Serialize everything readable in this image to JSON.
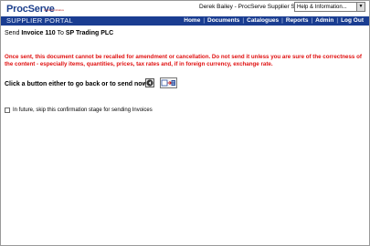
{
  "brand": {
    "logo_text": "ProcServe",
    "logo_sub": "A Fiscal initiative"
  },
  "header": {
    "user_info": "Derek Bailey - ProcServe Supplier Solutions Limited",
    "help_select": "Help & Information..."
  },
  "nav": {
    "portal_title": "SUPPLIER PORTAL",
    "links": [
      "Home",
      "Documents",
      "Catalogues",
      "Reports",
      "Admin",
      "Log Out"
    ],
    "separator": "|"
  },
  "send": {
    "prefix": "Send",
    "doc": "Invoice 110",
    "to": "To",
    "recipient": "SP Trading PLC"
  },
  "warning": "Once sent, this document cannot be recalled for amendment or cancellation. Do not send it unless you are sure of the correctness of the content - especially items, quantities, prices, tax rates and, if in foreign currency, exchange rate.",
  "prompt": "Click a button either to go back or to send now.",
  "skip_option": {
    "label": "In future, skip this confirmation stage for sending Invoices",
    "checked": false
  },
  "colors": {
    "nav_bg": "#1a3d91",
    "warning": "#e01010",
    "logo": "#1c3f8c"
  }
}
